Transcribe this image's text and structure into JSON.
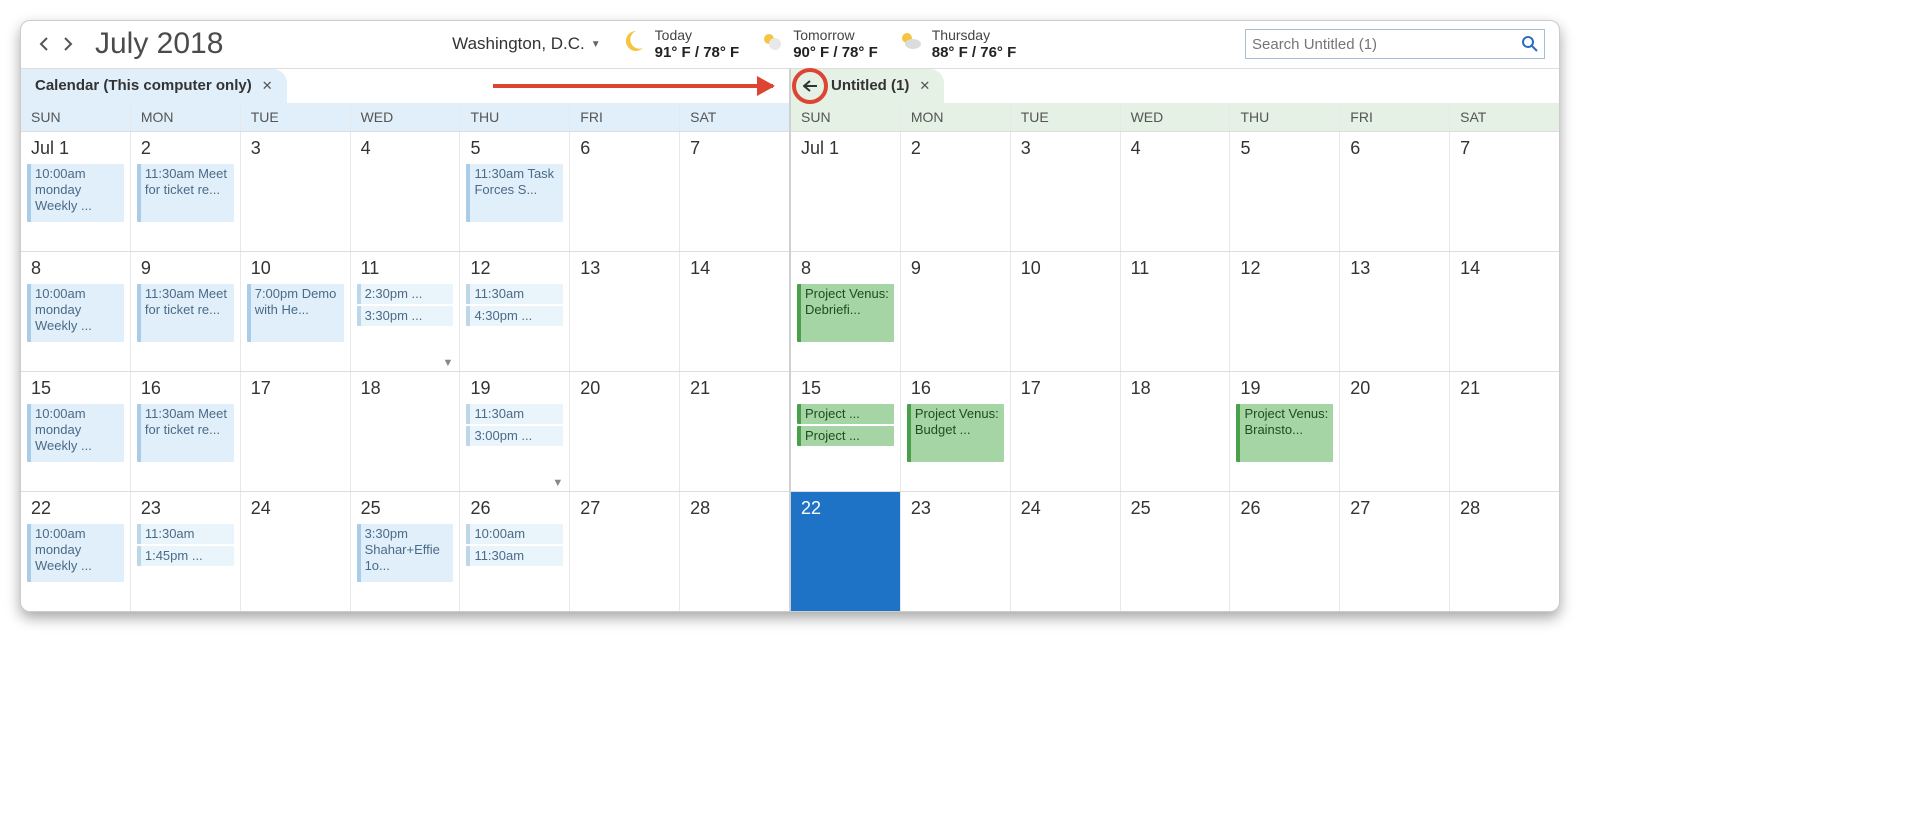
{
  "header": {
    "title": "July 2018",
    "location": "Washington, D.C.",
    "weather": [
      {
        "label": "Today",
        "temp": "91° F / 78° F",
        "icon": "moon"
      },
      {
        "label": "Tomorrow",
        "temp": "90° F / 78° F",
        "icon": "sun"
      },
      {
        "label": "Thursday",
        "temp": "88° F / 76° F",
        "icon": "cloud"
      }
    ],
    "search_placeholder": "Search Untitled (1)"
  },
  "day_names": [
    "SUN",
    "MON",
    "TUE",
    "WED",
    "THU",
    "FRI",
    "SAT"
  ],
  "left": {
    "tab_label": "Calendar (This computer only)",
    "weeks": [
      [
        {
          "date": "Jul 1",
          "events": [
            {
              "t": "10:00am monday Weekly ...",
              "cls": "blue tall"
            }
          ]
        },
        {
          "date": "2",
          "events": [
            {
              "t": "11:30am Meet for ticket re...",
              "cls": "blue tall"
            }
          ]
        },
        {
          "date": "3",
          "events": []
        },
        {
          "date": "4",
          "events": []
        },
        {
          "date": "5",
          "events": [
            {
              "t": "11:30am Task Forces S...",
              "cls": "blue tall"
            }
          ]
        },
        {
          "date": "6",
          "events": []
        },
        {
          "date": "7",
          "events": []
        }
      ],
      [
        {
          "date": "8",
          "events": [
            {
              "t": "10:00am monday Weekly ...",
              "cls": "blue tall"
            }
          ]
        },
        {
          "date": "9",
          "events": [
            {
              "t": "11:30am Meet for ticket re...",
              "cls": "blue tall"
            }
          ]
        },
        {
          "date": "10",
          "events": [
            {
              "t": "7:00pm Demo with He...",
              "cls": "blue tall"
            }
          ]
        },
        {
          "date": "11",
          "events": [
            {
              "t": "2:30pm ...",
              "cls": "lblue"
            },
            {
              "t": "3:30pm ...",
              "cls": "lblue"
            }
          ],
          "overflow": true
        },
        {
          "date": "12",
          "events": [
            {
              "t": "11:30am",
              "cls": "lblue"
            },
            {
              "t": "4:30pm ...",
              "cls": "lblue"
            }
          ]
        },
        {
          "date": "13",
          "events": []
        },
        {
          "date": "14",
          "events": []
        }
      ],
      [
        {
          "date": "15",
          "events": [
            {
              "t": "10:00am monday Weekly ...",
              "cls": "blue tall"
            }
          ]
        },
        {
          "date": "16",
          "events": [
            {
              "t": "11:30am Meet for ticket re...",
              "cls": "blue tall"
            }
          ]
        },
        {
          "date": "17",
          "events": []
        },
        {
          "date": "18",
          "events": []
        },
        {
          "date": "19",
          "events": [
            {
              "t": "11:30am",
              "cls": "lblue"
            },
            {
              "t": "3:00pm ...",
              "cls": "lblue"
            }
          ],
          "overflow": true
        },
        {
          "date": "20",
          "events": []
        },
        {
          "date": "21",
          "events": []
        }
      ],
      [
        {
          "date": "22",
          "events": [
            {
              "t": "10:00am monday Weekly ...",
              "cls": "blue tall"
            }
          ]
        },
        {
          "date": "23",
          "events": [
            {
              "t": "11:30am",
              "cls": "lblue"
            },
            {
              "t": "1:45pm ...",
              "cls": "lblue"
            }
          ]
        },
        {
          "date": "24",
          "events": []
        },
        {
          "date": "25",
          "events": [
            {
              "t": "3:30pm Shahar+Effie 1o...",
              "cls": "blue tall"
            }
          ]
        },
        {
          "date": "26",
          "events": [
            {
              "t": "10:00am",
              "cls": "lblue"
            },
            {
              "t": "11:30am",
              "cls": "lblue"
            }
          ]
        },
        {
          "date": "27",
          "events": []
        },
        {
          "date": "28",
          "events": []
        }
      ]
    ]
  },
  "right": {
    "tab_label": "Untitled (1)",
    "weeks": [
      [
        {
          "date": "Jul 1",
          "events": []
        },
        {
          "date": "2",
          "events": []
        },
        {
          "date": "3",
          "events": []
        },
        {
          "date": "4",
          "events": []
        },
        {
          "date": "5",
          "events": []
        },
        {
          "date": "6",
          "events": []
        },
        {
          "date": "7",
          "events": []
        }
      ],
      [
        {
          "date": "8",
          "events": [
            {
              "t": "Project Venus: Debriefi...",
              "cls": "green tall"
            }
          ]
        },
        {
          "date": "9",
          "events": []
        },
        {
          "date": "10",
          "events": []
        },
        {
          "date": "11",
          "events": []
        },
        {
          "date": "12",
          "events": []
        },
        {
          "date": "13",
          "events": []
        },
        {
          "date": "14",
          "events": []
        }
      ],
      [
        {
          "date": "15",
          "events": [
            {
              "t": "Project ...",
              "cls": "green"
            },
            {
              "t": "Project ...",
              "cls": "green"
            }
          ]
        },
        {
          "date": "16",
          "events": [
            {
              "t": "Project Venus: Budget ...",
              "cls": "green tall"
            }
          ]
        },
        {
          "date": "17",
          "events": []
        },
        {
          "date": "18",
          "events": []
        },
        {
          "date": "19",
          "events": [
            {
              "t": "Project Venus: Brainsto...",
              "cls": "green tall"
            }
          ]
        },
        {
          "date": "20",
          "events": []
        },
        {
          "date": "21",
          "events": []
        }
      ],
      [
        {
          "date": "22",
          "events": [],
          "selected": true
        },
        {
          "date": "23",
          "events": []
        },
        {
          "date": "24",
          "events": []
        },
        {
          "date": "25",
          "events": []
        },
        {
          "date": "26",
          "events": []
        },
        {
          "date": "27",
          "events": []
        },
        {
          "date": "28",
          "events": []
        }
      ]
    ]
  }
}
